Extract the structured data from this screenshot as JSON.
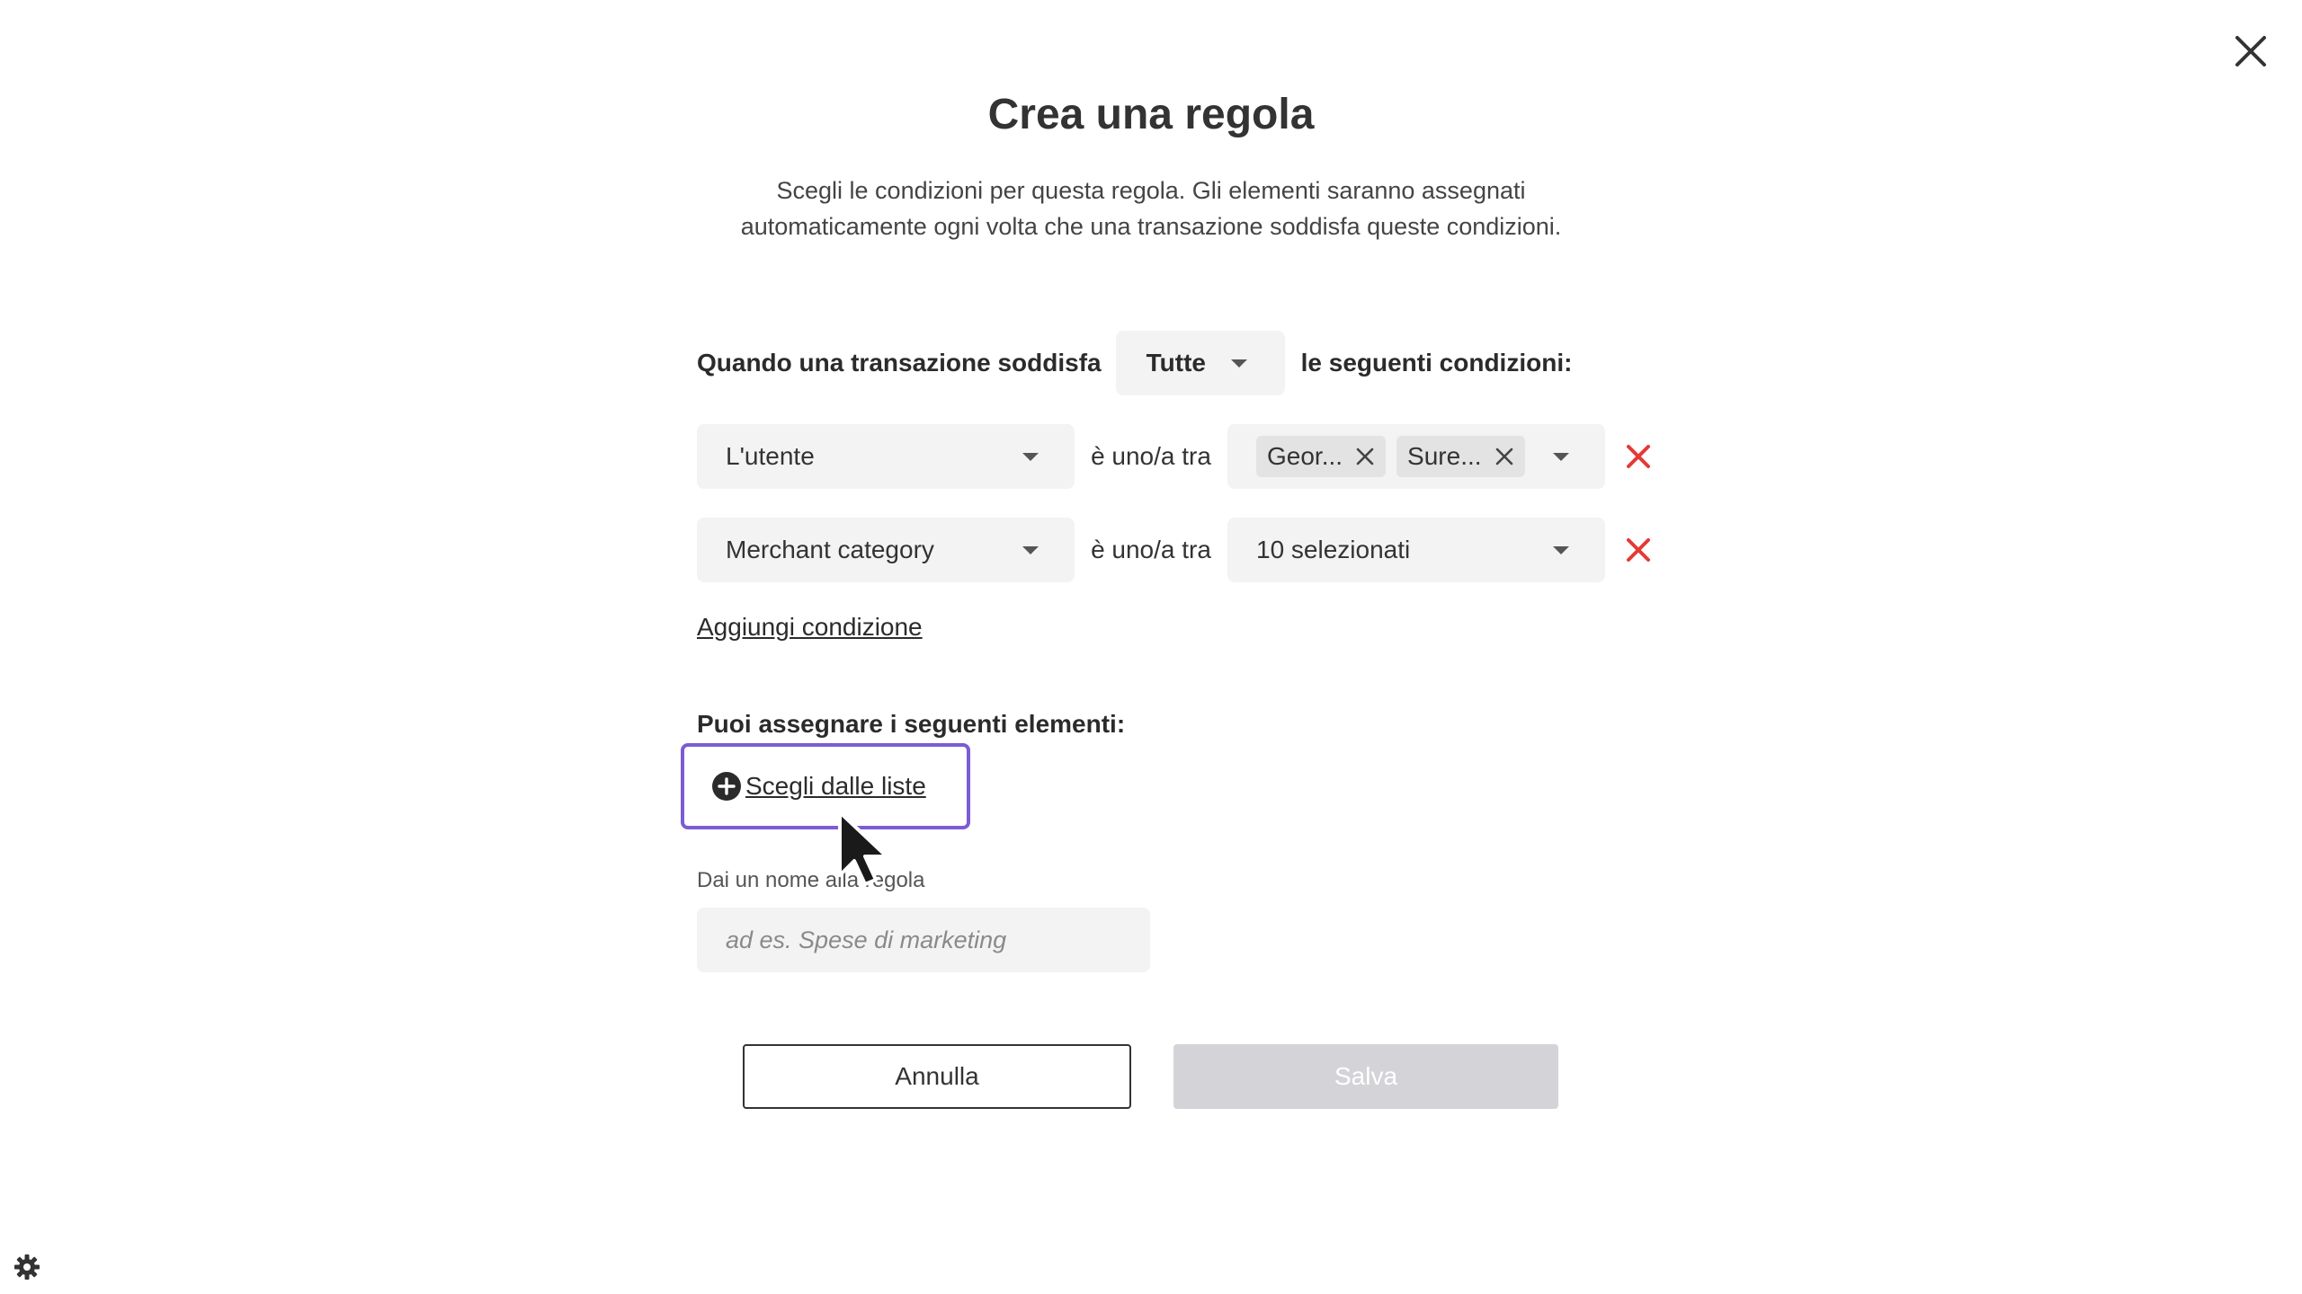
{
  "dialog": {
    "title": "Crea una regola",
    "description": "Scegli le condizioni per questa regola. Gli elementi saranno assegnati automaticamente ogni volta che una transazione soddisfa queste condizioni."
  },
  "match": {
    "prefix": "Quando una transazione soddisfa",
    "selected": "Tutte",
    "suffix": "le seguenti condizioni:"
  },
  "conditions": [
    {
      "field": "L'utente",
      "operator": "è uno/a tra",
      "chips": [
        "Geor...",
        "Sure..."
      ]
    },
    {
      "field": "Merchant category",
      "operator": "è uno/a tra",
      "value": "10 selezionati"
    }
  ],
  "add_condition_label": "Aggiungi condizione",
  "assign": {
    "label": "Puoi assegnare i seguenti elementi:",
    "choose_label": "Scegli dalle liste"
  },
  "rule_name": {
    "label": "Dai un nome alla regola",
    "placeholder": "ad es. Spese di marketing",
    "value": ""
  },
  "buttons": {
    "cancel": "Annulla",
    "save": "Salva"
  },
  "colors": {
    "accent_outline": "#7b5cd6",
    "remove_red": "#e53935",
    "disabled_button": "#d4d4d8"
  },
  "icons": {
    "close": "close-icon",
    "caret": "chevron-down-icon",
    "remove": "remove-x-icon",
    "plus": "plus-circle-icon",
    "settings": "gear-icon"
  }
}
